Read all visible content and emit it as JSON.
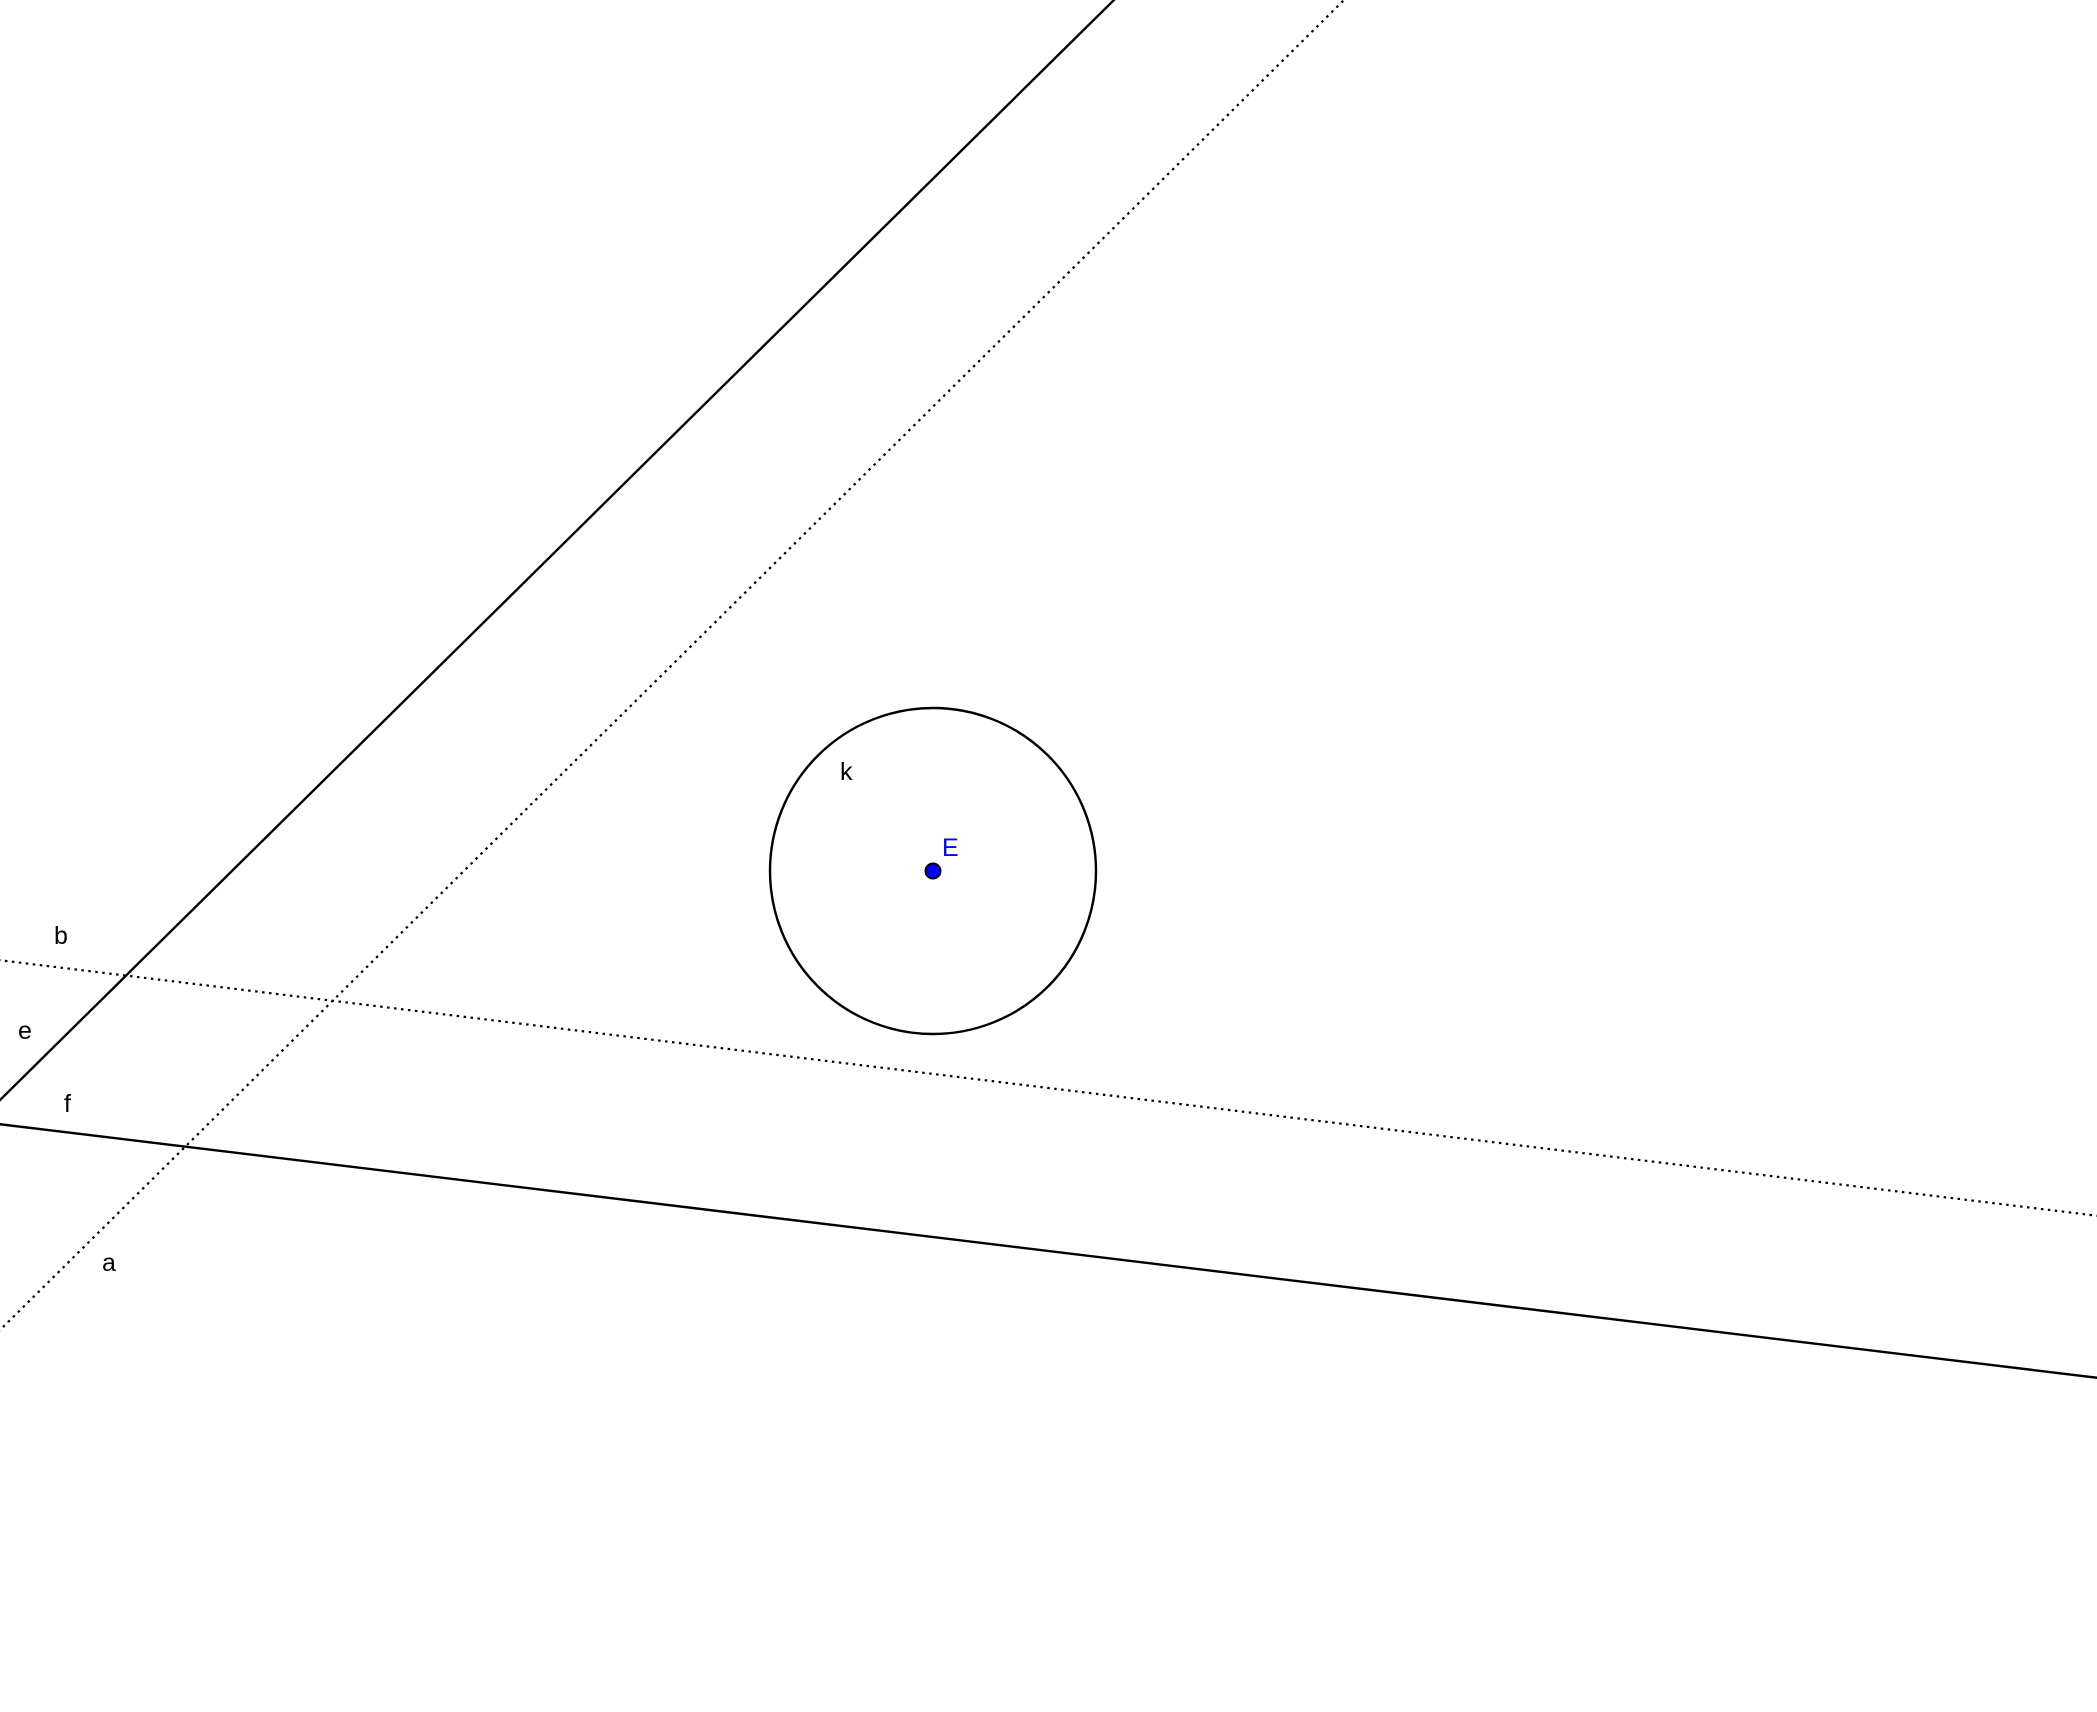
{
  "figure": {
    "background_color": "#ffffff",
    "object_color": "#000000",
    "point_color": "#0000ff"
  },
  "objects": {
    "line_e": {
      "label": "e",
      "style": "solid"
    },
    "line_f": {
      "label": "f",
      "style": "solid"
    },
    "line_a": {
      "label": "a",
      "style": "dotted"
    },
    "line_b": {
      "label": "b",
      "style": "dotted"
    },
    "circle_k": {
      "label": "k",
      "style": "solid"
    },
    "point_E": {
      "label": "E"
    }
  }
}
